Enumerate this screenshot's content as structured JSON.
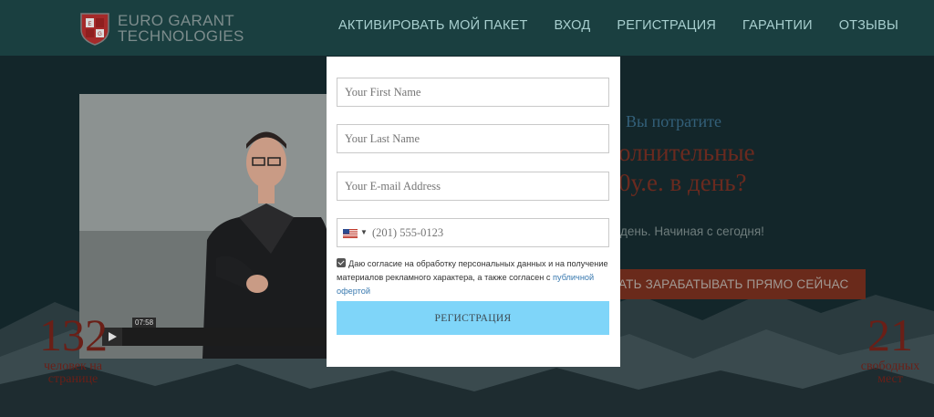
{
  "header": {
    "logo_line1": "EURO GARANT",
    "logo_line2": "TECHNOLOGIES",
    "nav": [
      {
        "label": "АКТИВИРОВАТЬ МОЙ ПАКЕТ"
      },
      {
        "label": "ВХОД"
      },
      {
        "label": "РЕГИСТРАЦИЯ"
      },
      {
        "label": "ГАРАНТИИ"
      },
      {
        "label": "ОТЗЫВЫ"
      }
    ]
  },
  "video": {
    "time": "07:58"
  },
  "side": {
    "small_title": "Вы потратите",
    "big_line1": "олнительные",
    "big_line2": "0у.е. в день?",
    "subtitle": "день. Начиная с сегодня!",
    "cta_label": "АТЬ ЗАРАБАТЫВАТЬ ПРЯМО СЕЙЧАС"
  },
  "counters": {
    "left": {
      "value": "132",
      "label_line1": "человек на",
      "label_line2": "странице"
    },
    "right": {
      "value": "21",
      "label_line1": "свободных",
      "label_line2": "мест"
    }
  },
  "modal": {
    "first_name_placeholder": "Your First Name",
    "last_name_placeholder": "Your Last Name",
    "email_placeholder": "Your E-mail Address",
    "phone_placeholder": "(201) 555-0123",
    "consent_text": "Даю согласие на обработку персональных данных и на получение материалов рекламного характера, а также согласен с ",
    "consent_link": "публичной офертой",
    "submit_label": "РЕГИСТРАЦИЯ"
  }
}
